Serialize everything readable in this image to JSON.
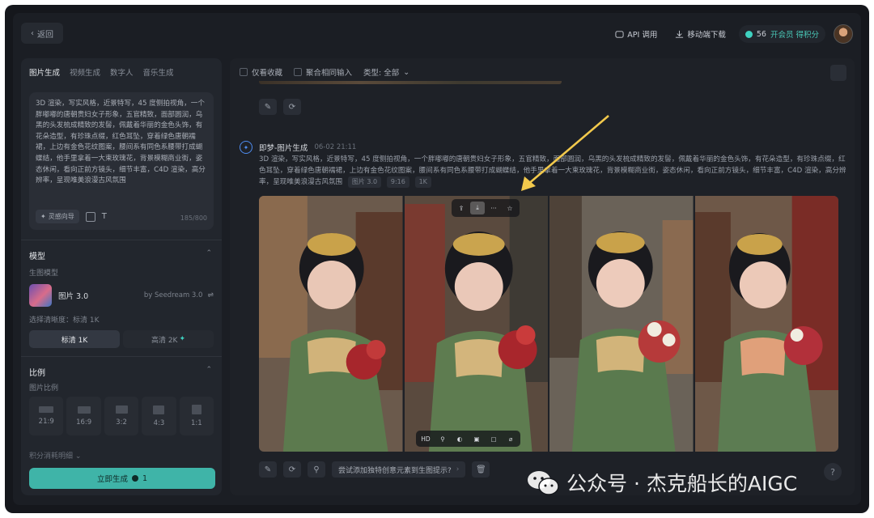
{
  "topbar": {
    "back_label": "返回",
    "api_label": "API 调用",
    "mobile_label": "移动端下载",
    "credits": "56",
    "vip_label": "开会员 得积分"
  },
  "left": {
    "tabs": [
      "图片生成",
      "视频生成",
      "数字人",
      "音乐生成"
    ],
    "prompt": "3D 渲染，写实风格，近景特写，45 度侧拍视角，一个胖嘟嘟的唐朝贵妇女子形象，五官精致，面部圆润，乌黑的头发梳成精致的发髻，佩戴着华丽的金色头饰，有花朵造型，有珍珠点缀，红色耳坠，穿着绿色唐朝襦裙，上边有金色花纹图案，腰间系有同色系腰带打成蝴蝶结，他手里拿着一大束玫瑰花，背景模糊商业街，姿态休闲，看向正前方镜头，细节丰富，C4D 渲染，高分辨率，呈现唯美浪漫古风氛围",
    "inspire_label": "灵感向导",
    "char_count": "185/800",
    "model_section": "模型",
    "model_sub": "生图模型",
    "model_name": "图片 3.0",
    "model_by": "by Seedream 3.0",
    "quality_label": "选择清晰度：标清 1K",
    "quality_options": [
      "标清 1K",
      "高清 2K"
    ],
    "ratio_section": "比例",
    "ratio_sub": "图片比例",
    "ratios": [
      "21:9",
      "16:9",
      "3:2",
      "4:3",
      "1:1"
    ],
    "cost_detail": "积分消耗明细",
    "generate_label": "立即生成",
    "generate_cost": "1"
  },
  "right": {
    "filters": [
      "仅看收藏",
      "聚合相同输入"
    ],
    "type_filter": "类型: 全部",
    "gen_title": "即梦-图片生成",
    "gen_time": "06-02  21:11",
    "gen_prompt": "3D 渲染，写实风格，近景特写，45 度侧拍视角，一个胖嘟嘟的唐朝贵妇女子形象，五官精致，面部圆润，乌黑的头发梳成精致的发髻，佩戴着华丽的金色头饰，有花朵造型，有珍珠点缀，红色耳坠，穿着绿色唐朝襦裙，上边有金色花纹图案，腰间系有同色系腰带打成蝴蝶结，他手里拿着一大束玫瑰花，背景模糊商业街，姿态休闲，看向正前方镜头，细节丰富，C4D 渲染，高分辨率，呈现唯美浪漫古风氛围",
    "tags": [
      "图片 3.0",
      "9:16",
      "1K"
    ],
    "hover_hd": "HD",
    "suggest_text": "尝试添加独特创意元素到生图提示?"
  },
  "watermark": "公众号 · 杰克船长的AIGC",
  "colors": {
    "accent": "#3fb4a8",
    "arrow": "#f2c94c",
    "bg": "#1b1e24"
  }
}
